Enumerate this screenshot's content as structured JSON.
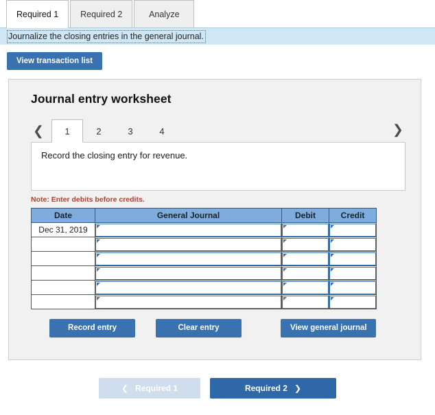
{
  "tabs": [
    {
      "label": "Required 1",
      "active": true
    },
    {
      "label": "Required 2",
      "active": false
    },
    {
      "label": "Analyze",
      "active": false
    }
  ],
  "instruction": "Journalize the closing entries in the general journal.",
  "toolbar": {
    "view_transaction_list_label": "View transaction list"
  },
  "panel": {
    "title": "Journal entry worksheet",
    "pager": {
      "prev_icon": "chevron-left",
      "next_icon": "chevron-right",
      "pages": [
        "1",
        "2",
        "3",
        "4"
      ],
      "active_page": "1"
    },
    "description": "Record the closing entry for revenue.",
    "note": "Note: Enter debits before credits.",
    "table": {
      "headers": [
        "Date",
        "General Journal",
        "Debit",
        "Credit"
      ],
      "rows": [
        {
          "date": "Dec 31, 2019",
          "general_journal": "",
          "debit": "",
          "credit": ""
        },
        {
          "date": "",
          "general_journal": "",
          "debit": "",
          "credit": ""
        },
        {
          "date": "",
          "general_journal": "",
          "debit": "",
          "credit": ""
        },
        {
          "date": "",
          "general_journal": "",
          "debit": "",
          "credit": ""
        },
        {
          "date": "",
          "general_journal": "",
          "debit": "",
          "credit": ""
        },
        {
          "date": "",
          "general_journal": "",
          "debit": "",
          "credit": ""
        }
      ]
    },
    "actions": {
      "record_entry_label": "Record entry",
      "clear_entry_label": "Clear entry",
      "view_general_journal_label": "View general journal"
    }
  },
  "bottom_nav": {
    "prev_label": "Required 1",
    "next_label": "Required 2",
    "prev_icon": "chevron-left",
    "next_icon": "chevron-right"
  },
  "colors": {
    "accent_blue": "#3a72b0",
    "nav_blue": "#2f68a8",
    "nav_disabled": "#cfdded",
    "header_blue": "#7eaddd",
    "banner_blue": "#cfe6f5",
    "note_red": "#c0392b",
    "panel_grey": "#f1f1f1"
  }
}
